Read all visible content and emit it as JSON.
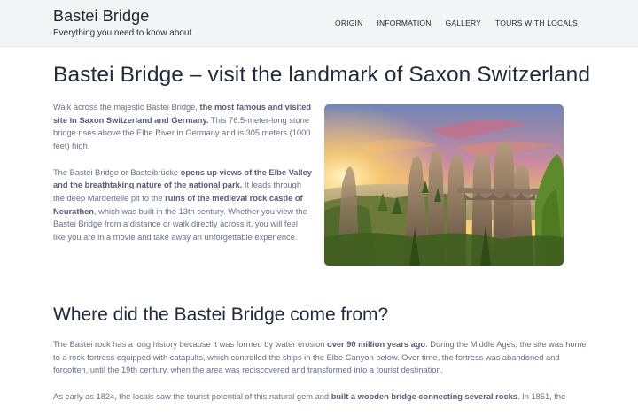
{
  "header": {
    "title": "Bastei Bridge",
    "tagline": "Everything you need to know about",
    "nav": [
      "ORIGIN",
      "INFORMATION",
      "GALLERY",
      "TOURS WITH LOCALS"
    ]
  },
  "page": {
    "title": "Bastei Bridge – visit the landmark of Saxon Switzerland"
  },
  "intro": {
    "p1": [
      "Walk across the majestic Bastei Bridge, ",
      "the most famous and visited site in Saxon Switzerland and Germany.",
      " This 76.5-meter-long stone bridge rises above the Elbe River in Germany and is 305 meters (1000 feet) high."
    ],
    "p2": [
      "The Bastei Bridge or Basteibrücke ",
      "opens up views of the Elbe Valley and the breathtaking nature of the national park.",
      " It leads through the deep Mardertelle pit to the ",
      "ruins of the medieval rock castle of Neurathen",
      ", which was built in the 13th century. Whether you view the Bastei Bridge from a distance or walk directly across it, you will feel like you are in a movie and take away an unforgettable experience."
    ]
  },
  "section": {
    "title": "Where did the Bastei Bridge come from?",
    "p1": [
      "The Bastei rock has a long history because it was formed by water erosion ",
      "over 90 million years ago",
      ". During the Middle Ages, the site was home to a rock fortress equipped with catapults, which controlled the ships in the Elbe Canyon below. Over time, the fortress was abandoned and forgotten, until the 19th century, when the area was rediscovered and transformed into a tourist destination."
    ],
    "p2": [
      "As early as 1824, the locals saw the tourist potential of this natural gem and ",
      "built a wooden bridge connecting several rocks",
      ". In 1851, the"
    ]
  },
  "image": {
    "subject": "bastei-bridge-sunset-photo"
  },
  "colors": {
    "header_bg": "#f2f4f6",
    "heading": "#1f2a3c",
    "body_text": "#6a6e8a",
    "bold_text": "#575b78"
  }
}
